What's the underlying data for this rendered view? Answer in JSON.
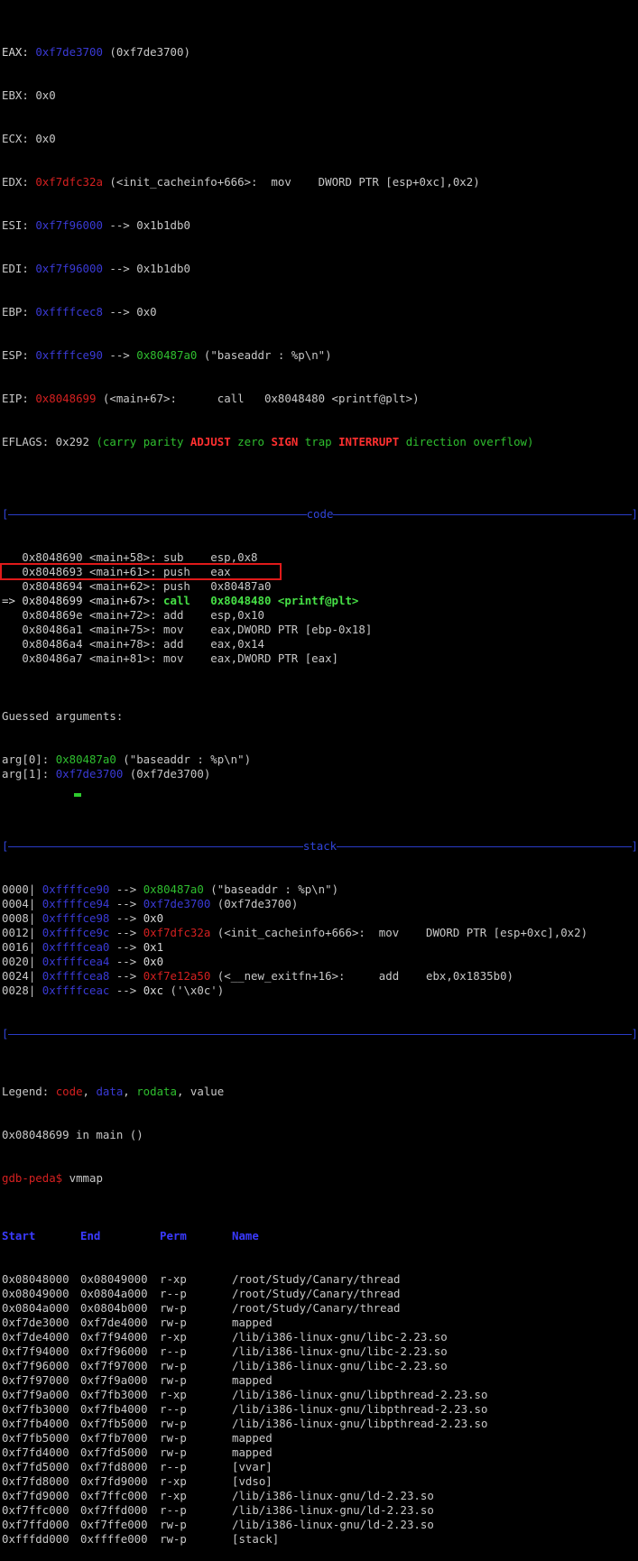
{
  "registers": {
    "eax": {
      "name": "EAX:",
      "val": "0xf7de3700",
      "extra": "(0xf7de3700)"
    },
    "ebx": {
      "name": "EBX:",
      "val": "0x0"
    },
    "ecx": {
      "name": "ECX:",
      "val": "0x0"
    },
    "edx": {
      "name": "EDX:",
      "val": "0xf7dfc32a",
      "extra": "(<init_cacheinfo+666>:  mov    DWORD PTR [esp+0xc],0x2)"
    },
    "esi": {
      "name": "ESI:",
      "val": "0xf7f96000",
      "arrow": "-->",
      "extra": "0x1b1db0"
    },
    "edi": {
      "name": "EDI:",
      "val": "0xf7f96000",
      "arrow": "-->",
      "extra": "0x1b1db0"
    },
    "ebp": {
      "name": "EBP:",
      "val": "0xffffcec8",
      "arrow": "-->",
      "extra": "0x0"
    },
    "esp": {
      "name": "ESP:",
      "val": "0xffffce90",
      "arrow": "-->",
      "ptr": "0x80487a0",
      "extra": "(\"baseaddr : %p\\n\")"
    },
    "eip": {
      "name": "EIP:",
      "val": "0x8048699",
      "extra": "(<main+67>:      call   0x8048480 <printf@plt>)"
    }
  },
  "eflags": {
    "label": "EFLAGS: 0x292 ",
    "open": "(",
    "flags": [
      {
        "t": "carry",
        "on": false
      },
      {
        "t": "parity",
        "on": false
      },
      {
        "t": "ADJUST",
        "on": true
      },
      {
        "t": "zero",
        "on": false
      },
      {
        "t": "SIGN",
        "on": true
      },
      {
        "t": "trap",
        "on": false
      },
      {
        "t": "INTERRUPT",
        "on": true
      },
      {
        "t": "direction",
        "on": false
      },
      {
        "t": "overflow",
        "on": false
      }
    ],
    "close": ")"
  },
  "sections": {
    "code": "code",
    "stack": "stack"
  },
  "code": [
    {
      "pre": "   ",
      "addr": "0x8048690 <main+58>: ",
      "ins": "sub    esp,0x8",
      "cur": false
    },
    {
      "pre": "   ",
      "addr": "0x8048693 <main+61>: ",
      "ins": "push   eax",
      "cur": false
    },
    {
      "pre": "   ",
      "addr": "0x8048694 <main+62>: ",
      "ins": "push   0x80487a0",
      "cur": false
    },
    {
      "pre": "=> ",
      "addr": "0x8048699 <main+67>: ",
      "ins": "call   0x8048480 <printf@plt>",
      "cur": true
    },
    {
      "pre": "   ",
      "addr": "0x804869e <main+72>: ",
      "ins": "add    esp,0x10",
      "cur": false
    },
    {
      "pre": "   ",
      "addr": "0x80486a1 <main+75>: ",
      "ins": "mov    eax,DWORD PTR [ebp-0x18]",
      "cur": false
    },
    {
      "pre": "   ",
      "addr": "0x80486a4 <main+78>: ",
      "ins": "add    eax,0x14",
      "cur": false
    },
    {
      "pre": "   ",
      "addr": "0x80486a7 <main+81>: ",
      "ins": "mov    eax,DWORD PTR [eax]",
      "cur": false
    }
  ],
  "guessed": {
    "title": "Guessed arguments:",
    "args": [
      {
        "label": "arg[0]: ",
        "val": "0x80487a0",
        "cls": "green",
        "extra": " (\"baseaddr : %p\\n\")"
      },
      {
        "label": "arg[1]: ",
        "val": "0xf7de3700",
        "cls": "blue",
        "extra": " (0xf7de3700)"
      }
    ]
  },
  "stack": [
    {
      "off": "0000| ",
      "addr": "0xffffce90",
      "arrow": " --> ",
      "val": "0x80487a0",
      "vcls": "green",
      "extra": " (\"baseaddr : %p\\n\")"
    },
    {
      "off": "0004| ",
      "addr": "0xffffce94",
      "arrow": " --> ",
      "val": "0xf7de3700",
      "vcls": "blue",
      "extra": " (0xf7de3700)"
    },
    {
      "off": "0008| ",
      "addr": "0xffffce98",
      "arrow": " --> ",
      "val": "0x0",
      "vcls": "white",
      "extra": ""
    },
    {
      "off": "0012| ",
      "addr": "0xffffce9c",
      "arrow": " --> ",
      "val": "0xf7dfc32a",
      "vcls": "red",
      "extra": " (<init_cacheinfo+666>:  mov    DWORD PTR [esp+0xc],0x2)"
    },
    {
      "off": "0016| ",
      "addr": "0xffffcea0",
      "arrow": " --> ",
      "val": "0x1",
      "vcls": "white",
      "extra": ""
    },
    {
      "off": "0020| ",
      "addr": "0xffffcea4",
      "arrow": " --> ",
      "val": "0x0",
      "vcls": "white",
      "extra": ""
    },
    {
      "off": "0024| ",
      "addr": "0xffffcea8",
      "arrow": " --> ",
      "val": "0xf7e12a50",
      "vcls": "red",
      "extra": " (<__new_exitfn+16>:     add    ebx,0x1835b0)"
    },
    {
      "off": "0028| ",
      "addr": "0xffffceac",
      "arrow": " --> ",
      "val": "0xc",
      "vcls": "white",
      "extra": " ('\\x0c')"
    }
  ],
  "legend": {
    "label": "Legend: ",
    "code": "code",
    "c1": ", ",
    "data": "data",
    "c2": ", ",
    "rodata": "rodata",
    "c3": ", ",
    "value": "value"
  },
  "location": "0x08048699 in main ()",
  "prompt": {
    "ps": "gdb-peda$ ",
    "cmd": "vmmap"
  },
  "vmmap": {
    "headers": [
      "Start",
      "End",
      "Perm",
      "Name"
    ],
    "rows": [
      [
        "0x08048000",
        "0x08049000",
        "r-xp",
        "/root/Study/Canary/thread"
      ],
      [
        "0x08049000",
        "0x0804a000",
        "r--p",
        "/root/Study/Canary/thread"
      ],
      [
        "0x0804a000",
        "0x0804b000",
        "rw-p",
        "/root/Study/Canary/thread"
      ],
      [
        "0xf7de3000",
        "0xf7de4000",
        "rw-p",
        "mapped"
      ],
      [
        "0xf7de4000",
        "0xf7f94000",
        "r-xp",
        "/lib/i386-linux-gnu/libc-2.23.so"
      ],
      [
        "0xf7f94000",
        "0xf7f96000",
        "r--p",
        "/lib/i386-linux-gnu/libc-2.23.so"
      ],
      [
        "0xf7f96000",
        "0xf7f97000",
        "rw-p",
        "/lib/i386-linux-gnu/libc-2.23.so"
      ],
      [
        "0xf7f97000",
        "0xf7f9a000",
        "rw-p",
        "mapped"
      ],
      [
        "0xf7f9a000",
        "0xf7fb3000",
        "r-xp",
        "/lib/i386-linux-gnu/libpthread-2.23.so"
      ],
      [
        "0xf7fb3000",
        "0xf7fb4000",
        "r--p",
        "/lib/i386-linux-gnu/libpthread-2.23.so"
      ],
      [
        "0xf7fb4000",
        "0xf7fb5000",
        "rw-p",
        "/lib/i386-linux-gnu/libpthread-2.23.so"
      ],
      [
        "0xf7fb5000",
        "0xf7fb7000",
        "rw-p",
        "mapped"
      ],
      [
        "0xf7fd4000",
        "0xf7fd5000",
        "rw-p",
        "mapped"
      ],
      [
        "0xf7fd5000",
        "0xf7fd8000",
        "r--p",
        "[vvar]"
      ],
      [
        "0xf7fd8000",
        "0xf7fd9000",
        "r-xp",
        "[vdso]"
      ],
      [
        "0xf7fd9000",
        "0xf7ffc000",
        "r-xp",
        "/lib/i386-linux-gnu/ld-2.23.so"
      ],
      [
        "0xf7ffc000",
        "0xf7ffd000",
        "r--p",
        "/lib/i386-linux-gnu/ld-2.23.so"
      ],
      [
        "0xf7ffd000",
        "0xf7ffe000",
        "rw-p",
        "/lib/i386-linux-gnu/ld-2.23.so"
      ],
      [
        "0xfffdd000",
        "0xffffe000",
        "rw-p",
        "[stack]"
      ]
    ]
  },
  "colors": {
    "highlight": "#e01a1a",
    "code": "#d42020",
    "data": "#3a3ad6",
    "rodata": "#2fbf2f",
    "separator": "#3044d8"
  }
}
